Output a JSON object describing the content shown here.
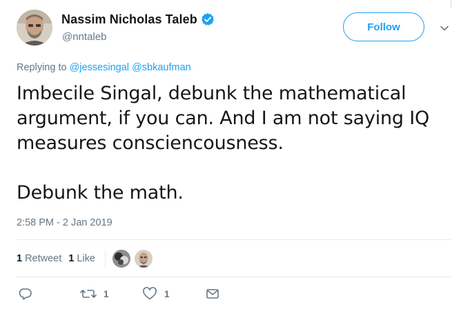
{
  "user": {
    "name": "Nassim Nicholas Taleb",
    "handle": "@nntaleb",
    "verified": true,
    "verified_color": "#1da1f2"
  },
  "follow_label": "Follow",
  "replying": {
    "prefix": "Replying to",
    "mentions": [
      "@jessesingal",
      "@sbkaufman"
    ]
  },
  "tweet": {
    "paragraphs": [
      "Imbecile Singal, debunk the mathematical\nargument, if you can. And I am not saying IQ\nmeasures consciencousness.",
      "Debunk the math."
    ]
  },
  "timestamp": "2:58 PM - 2 Jan 2019",
  "stats": {
    "retweets": {
      "count": "1",
      "label": "Retweet"
    },
    "likes": {
      "count": "1",
      "label": "Like"
    }
  },
  "actions": {
    "reply": {
      "icon": "reply-icon",
      "count": ""
    },
    "retweet": {
      "icon": "retweet-icon",
      "count": "1"
    },
    "like": {
      "icon": "heart-icon",
      "count": "1"
    },
    "message": {
      "icon": "envelope-icon",
      "count": ""
    }
  },
  "colors": {
    "accent": "#1da1f2",
    "muted": "#657786",
    "text": "#14171a",
    "divider": "#e6ecf0"
  }
}
